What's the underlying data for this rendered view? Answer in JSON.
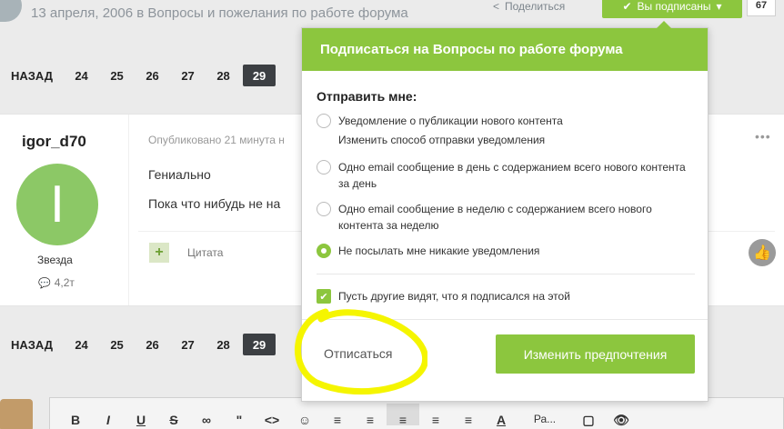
{
  "header": {
    "topic_meta": "13 апреля, 2006 в Вопросы и пожелания по работе форума",
    "share_label": "Поделиться",
    "follow_label": "Вы подписаны",
    "follow_count": "67"
  },
  "pagination": {
    "back_label": "НАЗАД",
    "pages": [
      "24",
      "25",
      "26",
      "27",
      "28",
      "29"
    ],
    "current": "29"
  },
  "post": {
    "author": "igor_d70",
    "avatar_letter": "I",
    "rank": "Звезда",
    "post_count": "4,2т",
    "date": "Опубликовано 21 минута н",
    "text1": "Гениально",
    "text2": "Пока что нибудь не на",
    "quote_label": "Цитата"
  },
  "follow_dropdown": {
    "title": "Подписаться на Вопросы по работе форума",
    "subtitle": "Отправить мне:",
    "options": [
      {
        "label": "Уведомление о публикации нового контента",
        "sub": "Изменить способ отправки уведомления",
        "checked": false
      },
      {
        "label": "Одно email сообщение в день с содержанием всего нового контента за день",
        "checked": false
      },
      {
        "label": "Одно email сообщение в неделю с содержанием всего нового контента за неделю",
        "checked": false
      },
      {
        "label": "Не посылать мне никакие уведомления",
        "checked": true
      }
    ],
    "show_follow_label": "Пусть другие видят, что я подписался на этой",
    "unsubscribe_label": "Отписаться",
    "change_label": "Изменить предпочтения"
  },
  "editor": {
    "tools": [
      "B",
      "I",
      "U",
      "S",
      "link",
      "quote",
      "code",
      "emoji",
      "bullet-list",
      "number-list",
      "align-left",
      "align-center",
      "align-right",
      "font-color",
      "paragraph",
      "preview",
      "view"
    ],
    "paragraph_label": "Ра..."
  },
  "colors": {
    "accent": "#8cc63e",
    "active_page": "#3c3f43",
    "annotation": "#f5f500"
  }
}
